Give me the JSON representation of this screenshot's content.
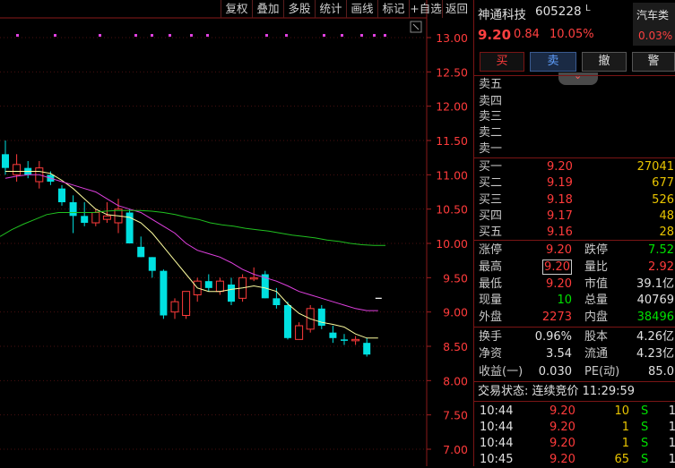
{
  "toolbar": [
    "复权",
    "叠加",
    "多股",
    "统计",
    "画线",
    "标记",
    "+自选",
    "返回"
  ],
  "price_axis": [
    "13.00",
    "12.50",
    "12.00",
    "11.50",
    "11.00",
    "10.50",
    "10.00",
    "9.50",
    "9.00",
    "8.50",
    "8.00",
    "7.50",
    "7.00"
  ],
  "colors": {
    "up": "#ff3b3b",
    "down": "#00e0e0",
    "ma5": "#ffffa0",
    "ma10": "#e040e0",
    "ma20": "#20c020",
    "marker": "#e040e0"
  },
  "chart_data": {
    "type": "candlestick",
    "ylim": [
      7.0,
      13.0
    ],
    "series": [
      {
        "name": "candles",
        "values": [
          {
            "o": 11.3,
            "h": 11.5,
            "l": 11.0,
            "c": 11.1
          },
          {
            "o": 11.0,
            "h": 11.3,
            "l": 10.9,
            "c": 11.15
          },
          {
            "o": 11.1,
            "h": 11.2,
            "l": 10.95,
            "c": 11.0
          },
          {
            "o": 10.9,
            "h": 11.2,
            "l": 10.8,
            "c": 11.1
          },
          {
            "o": 11.0,
            "h": 11.05,
            "l": 10.85,
            "c": 10.9
          },
          {
            "o": 10.8,
            "h": 10.85,
            "l": 10.55,
            "c": 10.6
          },
          {
            "o": 10.6,
            "h": 10.7,
            "l": 10.15,
            "c": 10.4
          },
          {
            "o": 10.4,
            "h": 10.6,
            "l": 10.25,
            "c": 10.3
          },
          {
            "o": 10.3,
            "h": 10.5,
            "l": 10.25,
            "c": 10.45
          },
          {
            "o": 10.35,
            "h": 10.6,
            "l": 10.3,
            "c": 10.4
          },
          {
            "o": 10.3,
            "h": 10.65,
            "l": 10.15,
            "c": 10.5
          },
          {
            "o": 10.45,
            "h": 10.5,
            "l": 10.0,
            "c": 10.0
          },
          {
            "o": 9.95,
            "h": 10.1,
            "l": 9.8,
            "c": 9.8
          },
          {
            "o": 9.8,
            "h": 9.8,
            "l": 9.5,
            "c": 9.6
          },
          {
            "o": 9.6,
            "h": 9.62,
            "l": 8.9,
            "c": 8.95
          },
          {
            "o": 9.0,
            "h": 9.2,
            "l": 8.9,
            "c": 9.15
          },
          {
            "o": 8.95,
            "h": 9.3,
            "l": 8.9,
            "c": 9.3
          },
          {
            "o": 9.25,
            "h": 9.5,
            "l": 9.15,
            "c": 9.45
          },
          {
            "o": 9.45,
            "h": 9.55,
            "l": 9.3,
            "c": 9.35
          },
          {
            "o": 9.3,
            "h": 9.5,
            "l": 9.25,
            "c": 9.45
          },
          {
            "o": 9.4,
            "h": 9.5,
            "l": 9.1,
            "c": 9.15
          },
          {
            "o": 9.2,
            "h": 9.55,
            "l": 9.15,
            "c": 9.5
          },
          {
            "o": 9.5,
            "h": 9.65,
            "l": 9.45,
            "c": 9.5
          },
          {
            "o": 9.55,
            "h": 9.6,
            "l": 9.2,
            "c": 9.2
          },
          {
            "o": 9.2,
            "h": 9.35,
            "l": 9.05,
            "c": 9.1
          },
          {
            "o": 9.1,
            "h": 9.15,
            "l": 8.6,
            "c": 8.62
          },
          {
            "o": 8.6,
            "h": 8.85,
            "l": 8.6,
            "c": 8.8
          },
          {
            "o": 8.75,
            "h": 9.1,
            "l": 8.7,
            "c": 9.05
          },
          {
            "o": 9.05,
            "h": 9.1,
            "l": 8.75,
            "c": 8.8
          },
          {
            "o": 8.7,
            "h": 8.8,
            "l": 8.55,
            "c": 8.62
          },
          {
            "o": 8.6,
            "h": 8.68,
            "l": 8.52,
            "c": 8.58
          },
          {
            "o": 8.6,
            "h": 8.65,
            "l": 8.52,
            "c": 8.6
          },
          {
            "o": 8.55,
            "h": 8.62,
            "l": 8.35,
            "c": 8.38
          }
        ]
      },
      {
        "name": "MA5",
        "values": [
          11.05,
          11.05,
          11.05,
          11.05,
          11.02,
          10.92,
          10.8,
          10.65,
          10.5,
          10.42,
          10.4,
          10.38,
          10.3,
          10.15,
          9.95,
          9.75,
          9.55,
          9.35,
          9.3,
          9.3,
          9.33,
          9.35,
          9.38,
          9.35,
          9.3,
          9.12,
          8.98,
          8.9,
          8.85,
          8.82,
          8.78,
          8.68,
          8.62,
          8.62
        ]
      },
      {
        "name": "MA10",
        "values": [
          10.95,
          10.98,
          11.0,
          11.0,
          10.95,
          10.9,
          10.85,
          10.8,
          10.75,
          10.65,
          10.55,
          10.5,
          10.45,
          10.35,
          10.25,
          10.15,
          10.0,
          9.9,
          9.85,
          9.8,
          9.72,
          9.62,
          9.55,
          9.5,
          9.45,
          9.38,
          9.3,
          9.25,
          9.2,
          9.15,
          9.1,
          9.05,
          9.02,
          9.02
        ]
      },
      {
        "name": "MA20",
        "values": [
          10.1,
          10.2,
          10.28,
          10.35,
          10.42,
          10.45,
          10.45,
          10.45,
          10.45,
          10.47,
          10.48,
          10.48,
          10.48,
          10.47,
          10.45,
          10.42,
          10.38,
          10.35,
          10.3,
          10.27,
          10.25,
          10.22,
          10.2,
          10.18,
          10.15,
          10.12,
          10.1,
          10.08,
          10.05,
          10.03,
          10.0,
          9.98,
          9.97,
          9.97
        ]
      }
    ]
  },
  "stock": {
    "name": "神通科技",
    "code": "605228",
    "tag": "L",
    "price": "9.20",
    "change": "0.84",
    "pct": "10.05%"
  },
  "sector": {
    "name": "汽车类",
    "pct": "0.03%"
  },
  "trade_buttons": [
    "买",
    "卖",
    "撤",
    "警"
  ],
  "sell_levels": [
    "卖五",
    "卖四",
    "卖三",
    "卖二",
    "卖一"
  ],
  "buy_levels": [
    {
      "label": "买一",
      "price": "9.20",
      "vol": "27041"
    },
    {
      "label": "买二",
      "price": "9.19",
      "vol": "677"
    },
    {
      "label": "买三",
      "price": "9.18",
      "vol": "526"
    },
    {
      "label": "买四",
      "price": "9.17",
      "vol": "48"
    },
    {
      "label": "买五",
      "price": "9.16",
      "vol": "28"
    }
  ],
  "stats": [
    {
      "l1": "涨停",
      "v1": "9.20",
      "l2": "跌停",
      "v2": "7.52"
    },
    {
      "l1": "最高",
      "v1": "9.20",
      "l2": "量比",
      "v2": "2.92"
    },
    {
      "l1": "最低",
      "v1": "9.20",
      "l2": "市值",
      "v2": "39.1亿"
    },
    {
      "l1": "现量",
      "v1": "10",
      "l2": "总量",
      "v2": "40769"
    },
    {
      "l1": "外盘",
      "v1": "2273",
      "l2": "内盘",
      "v2": "38496"
    }
  ],
  "fundamentals": [
    {
      "l1": "换手",
      "v1": "0.96%",
      "l2": "股本",
      "v2": "4.26亿"
    },
    {
      "l1": "净资",
      "v1": "3.54",
      "l2": "流通",
      "v2": "4.23亿"
    },
    {
      "l1": "收益(一)",
      "v1": "0.030",
      "l2": "PE(动)",
      "v2": "85.0"
    }
  ],
  "trade_status": "交易状态: 连续竞价 11:29:59",
  "ticks": [
    {
      "time": "10:44",
      "price": "9.20",
      "vol": "10",
      "side": "S",
      "n": "1"
    },
    {
      "time": "10:44",
      "price": "9.20",
      "vol": "1",
      "side": "S",
      "n": "1"
    },
    {
      "time": "10:44",
      "price": "9.20",
      "vol": "1",
      "side": "S",
      "n": "1"
    },
    {
      "time": "10:45",
      "price": "9.20",
      "vol": "65",
      "side": "S",
      "n": "1"
    }
  ]
}
